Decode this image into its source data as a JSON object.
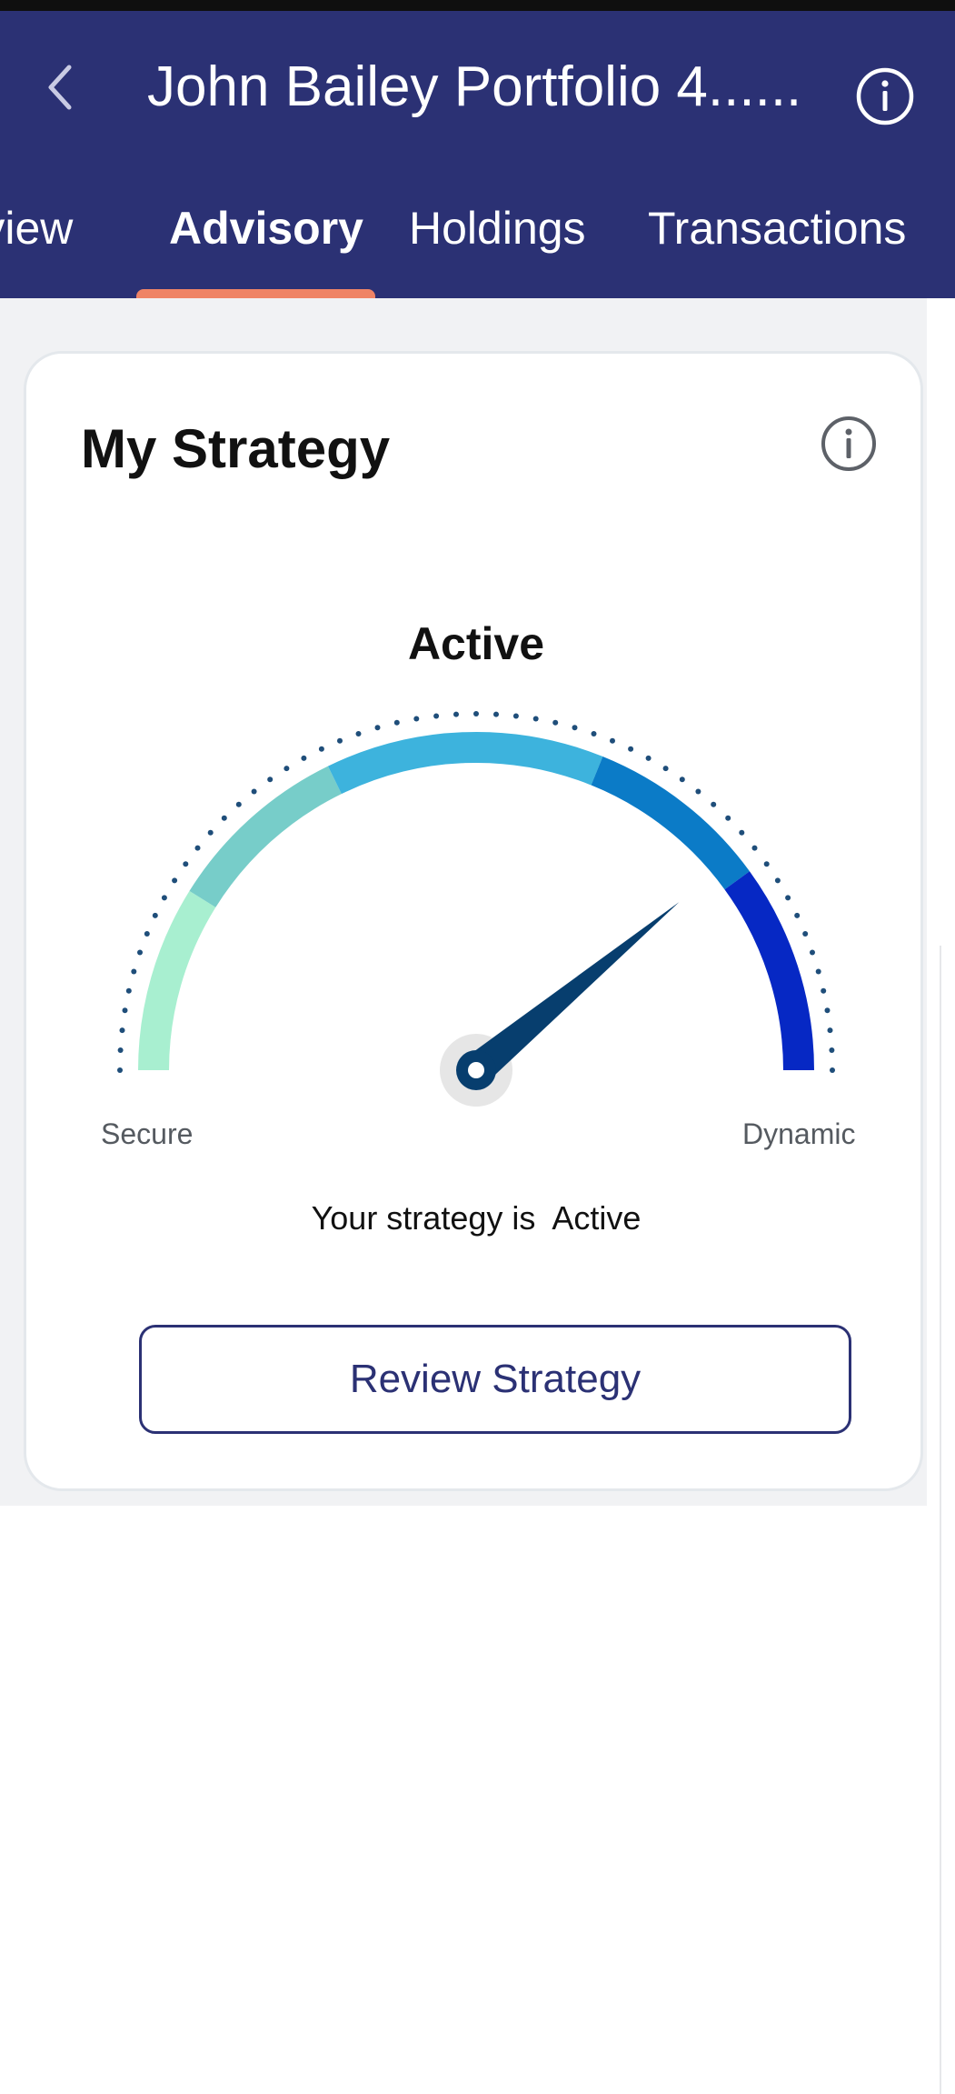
{
  "header": {
    "title": "John Bailey Portfolio 4......",
    "back_icon": "chevron-left-icon",
    "info_icon": "info-circle-icon",
    "background": "#2b3174"
  },
  "tabs": [
    {
      "label": "Overview"
    },
    {
      "label": "Advisory",
      "active": true
    },
    {
      "label": "Holdings"
    },
    {
      "label": "Transactions"
    }
  ],
  "tab_indicator_color": "#ef8466",
  "card": {
    "title": "My Strategy",
    "info_icon": "info-circle-icon",
    "gauge": {
      "current_label": "Active",
      "min_label": "Secure",
      "max_label": "Dynamic",
      "needle_value": 0.78,
      "segments": [
        {
          "color": "#a8efd0"
        },
        {
          "color": "#77cdc9"
        },
        {
          "color": "#3db3dd"
        },
        {
          "color": "#0b7bc7"
        },
        {
          "color": "#0628c4"
        }
      ],
      "needle_color": "#073e6e"
    },
    "strategy_text": "Your strategy is  Active",
    "review_button_label": "Review Strategy"
  }
}
